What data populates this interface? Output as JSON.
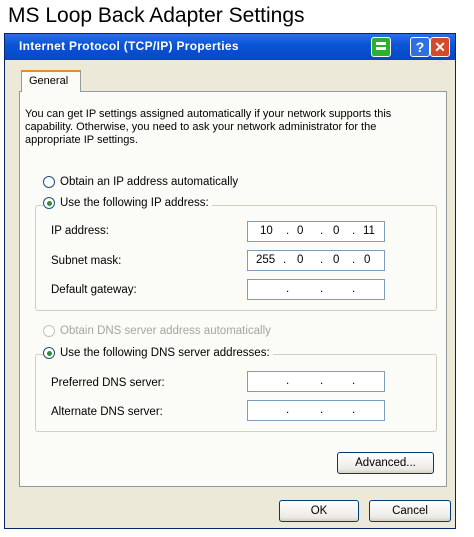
{
  "caption": "MS Loop Back Adapter Settings",
  "window": {
    "title": "Internet Protocol (TCP/IP) Properties",
    "help_glyph": "?",
    "close_glyph": "✕"
  },
  "tab": {
    "label": "General"
  },
  "description": "You can get IP settings assigned automatically if your network supports this capability. Otherwise, you need to ask your network administrator for the appropriate IP settings.",
  "ip_section": {
    "auto_label": "Obtain an IP address automatically",
    "manual_label": "Use the following IP address:",
    "selected": "manual",
    "fields": [
      {
        "label": "IP address:",
        "octets": [
          "10",
          "0",
          "0",
          "11"
        ]
      },
      {
        "label": "Subnet mask:",
        "octets": [
          "255",
          "0",
          "0",
          "0"
        ]
      },
      {
        "label": "Default gateway:",
        "octets": [
          "",
          "",
          "",
          ""
        ]
      }
    ]
  },
  "dns_section": {
    "auto_label": "Obtain DNS server address automatically",
    "manual_label": "Use the following DNS server addresses:",
    "selected": "manual",
    "auto_disabled": true,
    "fields": [
      {
        "label": "Preferred DNS server:",
        "octets": [
          "",
          "",
          "",
          ""
        ]
      },
      {
        "label": "Alternate DNS server:",
        "octets": [
          "",
          "",
          "",
          ""
        ]
      }
    ]
  },
  "buttons": {
    "advanced": "Advanced...",
    "ok": "OK",
    "cancel": "Cancel"
  },
  "dot": "."
}
